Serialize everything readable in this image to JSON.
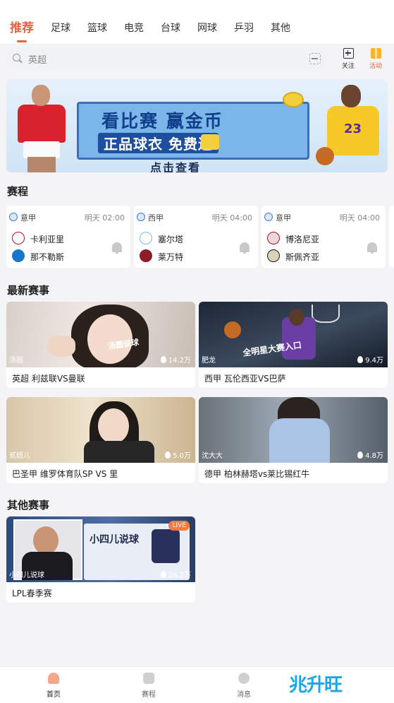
{
  "tabs": [
    {
      "label": "推荐",
      "active": true
    },
    {
      "label": "足球"
    },
    {
      "label": "篮球"
    },
    {
      "label": "电竞"
    },
    {
      "label": "台球"
    },
    {
      "label": "网球"
    },
    {
      "label": "乒羽"
    },
    {
      "label": "其他"
    }
  ],
  "search": {
    "placeholder": "英超"
  },
  "actions": {
    "follow": "关注",
    "activity": "活动"
  },
  "banner": {
    "title": "看比赛 赢金币",
    "subtitle": "正品球衣 免费送",
    "cta": "点击查看",
    "jersey_number": "23"
  },
  "sections": {
    "schedule": "赛程",
    "latest": "最新赛事",
    "other": "其他赛事"
  },
  "matches": [
    {
      "league": "意甲",
      "time": "明天 02:00",
      "home": "卡利亚里",
      "away": "那不勒斯",
      "home_color": "#b3122d",
      "away_color": "#1676c9"
    },
    {
      "league": "西甲",
      "time": "明天 04:00",
      "home": "塞尔塔",
      "away": "莱万特",
      "home_color": "#7fb7e8",
      "away_color": "#8e1b28"
    },
    {
      "league": "意甲",
      "time": "明天 04:00",
      "home": "博洛尼亚",
      "away": "斯佩齐亚",
      "home_color": "#a5152c",
      "away_color": "#1a1a1a"
    }
  ],
  "latest": [
    {
      "streamer": "汤圆",
      "heat": "14.2万",
      "title": "英超 利兹联VS曼联",
      "overlay": "汤圆说球"
    },
    {
      "streamer": "肥龙",
      "heat": "9.4万",
      "title": "西甲 瓦伦西亚VS巴萨",
      "overlay": "全明星大赛入口"
    },
    {
      "streamer": "贰妞儿",
      "heat": "5.0万",
      "title": "巴圣甲 维罗体育队SP VS 里"
    },
    {
      "streamer": "沈大大",
      "heat": "4.8万",
      "title": "德甲 柏林赫塔vs莱比锡红牛"
    }
  ],
  "other": [
    {
      "streamer": "小四儿说球",
      "heat": "26.2万",
      "title": "LPL春季赛",
      "overlay": "小四儿说球",
      "badge": "LIVE"
    }
  ],
  "bottom_nav": [
    {
      "label": "首页",
      "active": true
    },
    {
      "label": "赛程"
    },
    {
      "label": "消息"
    }
  ],
  "watermark": "兆升旺"
}
